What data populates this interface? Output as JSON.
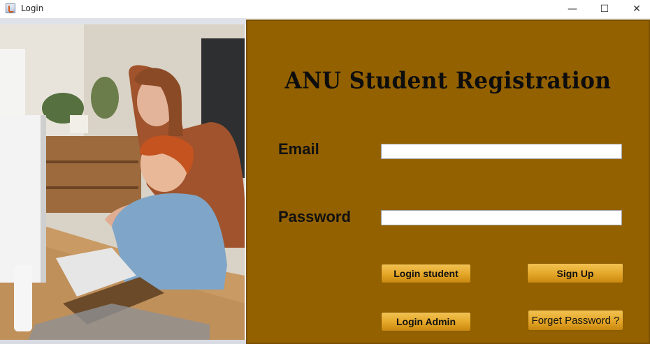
{
  "window": {
    "title": "Login",
    "minimize_glyph": "—",
    "maximize_glyph": "☐",
    "close_glyph": "✕"
  },
  "photo": {
    "icon": "classroom-photo"
  },
  "form": {
    "heading": "ANU Student Registration",
    "email_label": "Email",
    "email_value": "",
    "password_label": "Password",
    "password_value": ""
  },
  "buttons": {
    "login_student": "Login student",
    "sign_up": "Sign Up",
    "login_admin": "Login Admin",
    "forget_password": "Forget Password ?"
  },
  "colors": {
    "panel": "#936100",
    "button": "#e4a627"
  }
}
